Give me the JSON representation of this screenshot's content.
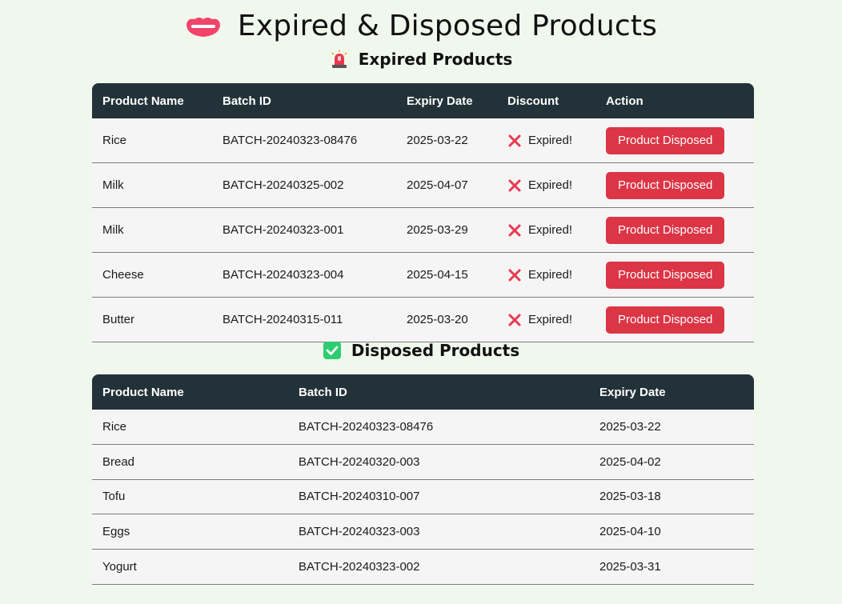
{
  "page": {
    "title": "Expired & Disposed Products",
    "title_icon": "lips-icon",
    "colors": {
      "background": "#f0f8ee",
      "table_header": "#233238",
      "row_background": "#f5f5f5",
      "dispose_button": "#dc3545",
      "expired_x": "#e8384f",
      "disposed_check": "#2ecc71"
    }
  },
  "expired_section": {
    "heading": "Expired Products",
    "icon": "siren-icon",
    "columns": [
      "Product Name",
      "Batch ID",
      "Expiry Date",
      "Discount",
      "Action"
    ],
    "rows": [
      {
        "name": "Rice",
        "batch": "BATCH-20240323-08476",
        "expiry": "2025-03-22",
        "discount": "Expired!",
        "action": "Product Disposed"
      },
      {
        "name": "Milk",
        "batch": "BATCH-20240325-002",
        "expiry": "2025-04-07",
        "discount": "Expired!",
        "action": "Product Disposed"
      },
      {
        "name": "Milk",
        "batch": "BATCH-20240323-001",
        "expiry": "2025-03-29",
        "discount": "Expired!",
        "action": "Product Disposed"
      },
      {
        "name": "Cheese",
        "batch": "BATCH-20240323-004",
        "expiry": "2025-04-15",
        "discount": "Expired!",
        "action": "Product Disposed"
      },
      {
        "name": "Butter",
        "batch": "BATCH-20240315-011",
        "expiry": "2025-03-20",
        "discount": "Expired!",
        "action": "Product Disposed"
      }
    ]
  },
  "disposed_section": {
    "heading": "Disposed Products",
    "icon": "check-box-icon",
    "columns": [
      "Product Name",
      "Batch ID",
      "Expiry Date"
    ],
    "rows": [
      {
        "name": "Rice",
        "batch": "BATCH-20240323-08476",
        "expiry": "2025-03-22"
      },
      {
        "name": "Bread",
        "batch": "BATCH-20240320-003",
        "expiry": "2025-04-02"
      },
      {
        "name": "Tofu",
        "batch": "BATCH-20240310-007",
        "expiry": "2025-03-18"
      },
      {
        "name": "Eggs",
        "batch": "BATCH-20240323-003",
        "expiry": "2025-04-10"
      },
      {
        "name": "Yogurt",
        "batch": "BATCH-20240323-002",
        "expiry": "2025-03-31"
      }
    ]
  }
}
